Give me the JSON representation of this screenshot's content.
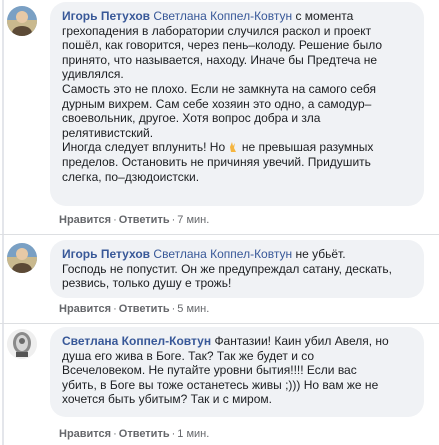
{
  "comments": [
    {
      "author": "Игорь Петухов",
      "mention": "Светлана Коппел-Ковтун",
      "lines": [
        "с момента",
        "грехопадения в лаборатории случился раскол и проект",
        "пошёл, как говорится, через пень–колоду. Решение было",
        "принято, что называется, находу. Иначе бы Предтеча не",
        "удивлялся.",
        "Самость это не плохо. Если не замкнута на самого себя",
        "дурным вихрем. Сам себе хозяин это одно, а самодур–",
        "своевольник, другое. Хотя вопрос добра и зла",
        "релятивистский.",
        "Иногда следует вплунить! Но",
        "не превышая разумных",
        "пределов. Остановить не причиняя увечий. Придушить",
        "слегка, по–дзюдоистски."
      ],
      "like_label": "Нравится",
      "reply_label": "Ответить",
      "time": "7 мин."
    },
    {
      "author": "Игорь Петухов",
      "mention": "Светлана Коппел-Ковтун",
      "lines": [
        "не убьёт.",
        "Господь не попустит. Он же предупреждал сатану, дескать,",
        "резвись, только душу е трожь!"
      ],
      "like_label": "Нравится",
      "reply_label": "Ответить",
      "time": "5 мин."
    },
    {
      "author": "Светлана Коппел-Ковтун",
      "mention": "",
      "lines": [
        "Фантазии! Каин убил Авеля, но",
        "душа его жива в Боге. Так? Так же будет и со",
        "Всечеловеком. Не путайте уровни бытия!!!! Если вас",
        "убить, в Боге вы тоже останетесь живы ;))) Но вам же не",
        "хочется быть убитым? Так и с миром."
      ],
      "like_label": "Нравится",
      "reply_label": "Ответить",
      "time": "1 мин."
    }
  ],
  "separator": "·",
  "icons": {
    "avatar_1": "user-photo-avatar-icon",
    "avatar_2": "user-photo-avatar-icon",
    "avatar_3": "user-photo-avatar-icon",
    "emoji": "fingers-crossed-emoji-icon"
  },
  "colors": {
    "bubble": "#f0f2f5",
    "name": "#385898",
    "meta": "#65676b"
  }
}
